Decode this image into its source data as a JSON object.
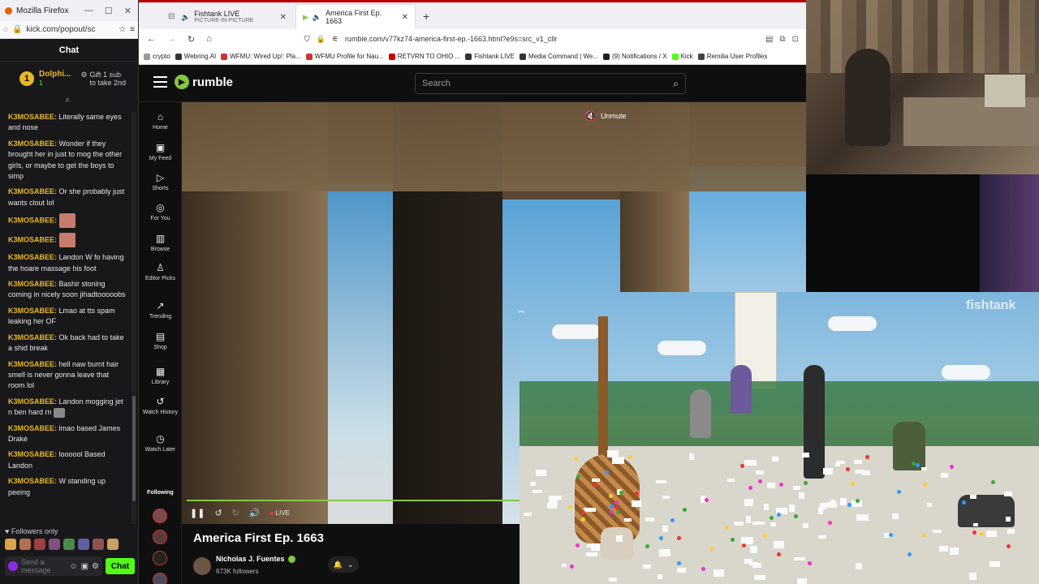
{
  "kick": {
    "titlebar": {
      "title": "Mozilla Firefox",
      "min": "—",
      "max": "☐",
      "close": "✕"
    },
    "urlbar": {
      "url": "kick.com/popout/sc"
    },
    "chat_header": "Chat",
    "pinned": {
      "badge": "1",
      "name": "Dolphi...",
      "count": "1",
      "gift_line1": "Gift 1 sub",
      "gift_line2": "to take 2nd"
    },
    "arrow": "⩡",
    "messages": [
      {
        "user": "K3MOSABEE:",
        "text": "Literally same eyes and nose"
      },
      {
        "user": "K3MOSABEE:",
        "text": "Wonder if they brought her in just to mog the other girls, or maybe to get the boys to simp"
      },
      {
        "user": "K3MOSABEE:",
        "text": "Or she probably just wants clout lol"
      },
      {
        "user": "K3MOSABEE:",
        "text": "",
        "emote": true
      },
      {
        "user": "K3MOSABEE:",
        "text": "",
        "emote": true
      },
      {
        "user": "K3MOSABEE:",
        "text": "Landon W fo having the hoare massage his foot"
      },
      {
        "user": "K3MOSABEE:",
        "text": "Bashir stoning coming in nicely soon jihadtooooobs"
      },
      {
        "user": "K3MOSABEE:",
        "text": "Lmao at tts spam leaking her OF"
      },
      {
        "user": "K3MOSABEE:",
        "text": "Ok back had to take a shid break"
      },
      {
        "user": "K3MOSABEE:",
        "text": "hell naw burnt hair smell is never gonna leave that room lol"
      },
      {
        "user": "K3MOSABEE:",
        "text": "Landon mogging jet n ben hard rn",
        "emote2": true
      },
      {
        "user": "K3MOSABEE:",
        "text": "lmao based James Drake"
      },
      {
        "user": "K3MOSABEE:",
        "text": "loooool Based Landon"
      },
      {
        "user": "K3MOSABEE:",
        "text": "W standing up peeing"
      }
    ],
    "followers_only": "♥ Followers only",
    "emote_colors": [
      "#d9a34a",
      "#b07050",
      "#a04040",
      "#805080",
      "#4a8a4a",
      "#6060a0",
      "#905050",
      "#c9a060"
    ],
    "input_placeholder": "Send a message",
    "chat_button": "Chat",
    "colors": {
      "accent": "#53fc18",
      "username": "#e8b923"
    }
  },
  "browser": {
    "tabs": [
      {
        "title": "Fishtank LIVE",
        "subtitle": "PICTURE-IN-PICTURE",
        "active": false
      },
      {
        "title": "America First Ep. 1663",
        "active": true
      }
    ],
    "tab_close": "✕",
    "new_tab": "+",
    "nav": {
      "back": "←",
      "forward": "→",
      "reload": "↻",
      "home": "⌂"
    },
    "url": "rumble.com/v77kz74-america-first-ep.-1663.html?e9s=src_v1_cllr",
    "bookmarks": [
      "crypto",
      "Webring.AI",
      "WFMU: Wired Up!: Pla...",
      "WFMU Profile for Nau...",
      "RETVRN TO OHIO ...",
      "Fishtank LIVE",
      "Media Command | We...",
      "(9) Notifications / X",
      "Kick",
      "Remilia User Profiles"
    ]
  },
  "rumble": {
    "logo_text": "rumble",
    "search_placeholder": "Search",
    "nav": [
      {
        "label": "Home",
        "icon": "⌂"
      },
      {
        "label": "My Feed",
        "icon": "▣"
      },
      {
        "label": "Shorts",
        "icon": "▷"
      },
      {
        "label": "For You",
        "icon": "◎"
      },
      {
        "label": "Browse",
        "icon": "▥"
      },
      {
        "label": "Editor Picks",
        "icon": "♙"
      },
      {
        "label": "Trending",
        "icon": "↗"
      },
      {
        "label": "Shop",
        "icon": "▤"
      },
      {
        "label": "Library",
        "icon": "▦"
      },
      {
        "label": "Watch History",
        "icon": "↺"
      },
      {
        "label": "Watch Later",
        "icon": "◷"
      }
    ],
    "following_label": "Following",
    "unmute": "Unmute",
    "controls": {
      "pause": "❚❚",
      "rewind": "↺",
      "forward": "↻",
      "volume": "🔊",
      "live": "LIVE"
    },
    "video_title": "America First Ep. 1663",
    "channel_name": "Nicholas J. Fuentes",
    "channel_followers": "673K followers",
    "bell": "🔔",
    "chevron": "⌄",
    "colors": {
      "accent": "#85c742"
    }
  },
  "pip": {
    "logo": "fishtank",
    "cursor": "⇔"
  }
}
